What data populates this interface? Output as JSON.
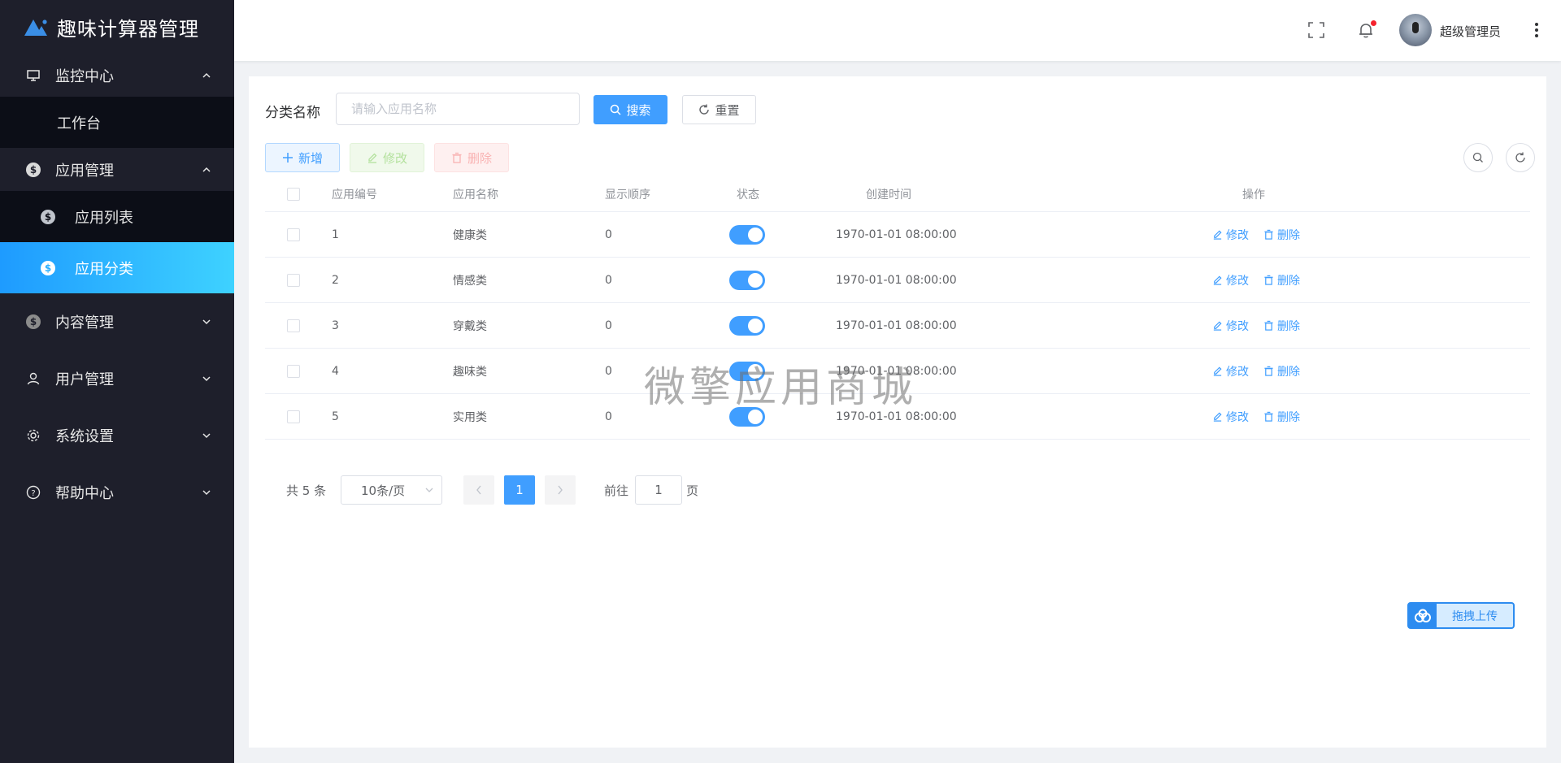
{
  "app": {
    "title": "趣味计算器管理"
  },
  "sidebar": {
    "groups": [
      {
        "label": "监控中心",
        "icon": "monitor-icon",
        "expanded": true,
        "children": [
          {
            "label": "工作台"
          }
        ]
      },
      {
        "label": "应用管理",
        "icon": "dollar-icon",
        "expanded": true,
        "children": [
          {
            "label": "应用列表",
            "icon": "dollar-icon"
          },
          {
            "label": "应用分类",
            "icon": "dollar-icon",
            "active": true
          }
        ]
      },
      {
        "label": "内容管理",
        "icon": "dollar-icon",
        "expanded": false
      },
      {
        "label": "用户管理",
        "icon": "user-icon",
        "expanded": false
      },
      {
        "label": "系统设置",
        "icon": "gear-icon",
        "expanded": false
      },
      {
        "label": "帮助中心",
        "icon": "help-icon",
        "expanded": false
      }
    ]
  },
  "header": {
    "user_name": "超级管理员",
    "notification_dot": true
  },
  "filter": {
    "label": "分类名称",
    "placeholder": "请输入应用名称",
    "search_label": "搜索",
    "reset_label": "重置"
  },
  "toolbar": {
    "add_label": "新增",
    "edit_label": "修改",
    "delete_label": "删除"
  },
  "table": {
    "columns": [
      "应用编号",
      "应用名称",
      "显示顺序",
      "状态",
      "创建时间",
      "操作"
    ],
    "rows": [
      {
        "id": "1",
        "name": "健康类",
        "order": "0",
        "status": true,
        "created": "1970-01-01 08:00:00"
      },
      {
        "id": "2",
        "name": "情感类",
        "order": "0",
        "status": true,
        "created": "1970-01-01 08:00:00"
      },
      {
        "id": "3",
        "name": "穿戴类",
        "order": "0",
        "status": true,
        "created": "1970-01-01 08:00:00"
      },
      {
        "id": "4",
        "name": "趣味类",
        "order": "0",
        "status": true,
        "created": "1970-01-01 08:00:00"
      },
      {
        "id": "5",
        "name": "实用类",
        "order": "0",
        "status": true,
        "created": "1970-01-01 08:00:00"
      }
    ],
    "row_edit_label": "修改",
    "row_delete_label": "删除"
  },
  "pagination": {
    "total_text": "共 5 条",
    "page_size": "10条/页",
    "current_page": "1",
    "goto_prefix": "前往",
    "goto_value": "1",
    "goto_suffix": "页"
  },
  "watermark": "微擎应用商城",
  "upload": {
    "label": "拖拽上传"
  },
  "colors": {
    "primary": "#409eff",
    "sidebar_bg": "#1e1f2b",
    "active_gradient_start": "#1e9bff",
    "active_gradient_end": "#3ed2ff"
  }
}
